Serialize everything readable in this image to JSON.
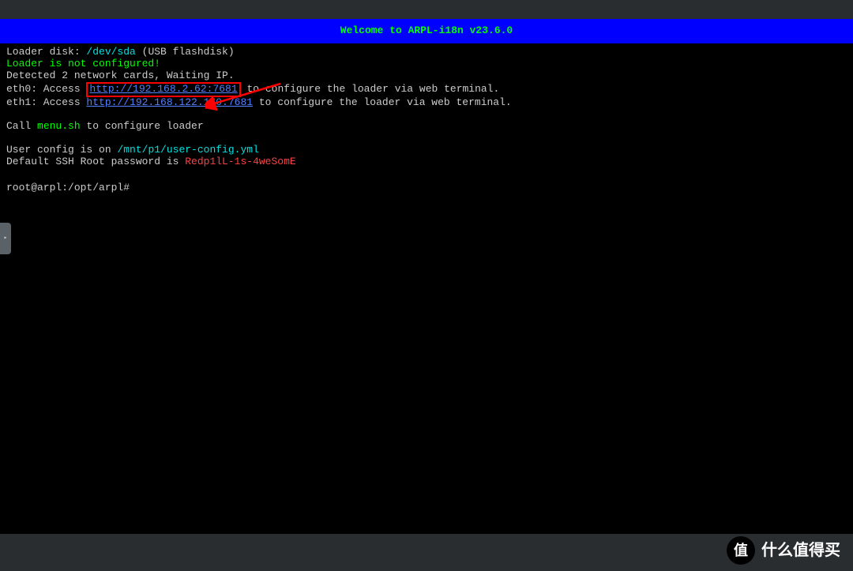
{
  "banner": {
    "text": "Welcome to ARPL-i18n v23.6.0"
  },
  "lines": {
    "loader_disk_label": "Loader disk: ",
    "loader_disk_path": "/dev/sda",
    "loader_disk_suffix": " (USB flashdisk)",
    "not_configured": "Loader is not configured!",
    "detected": "Detected 2 network cards, Waiting IP.",
    "eth0_prefix": "eth0: Access ",
    "eth0_url": "http://192.168.2.62:7681",
    "eth0_suffix": " to configure the loader via web terminal.",
    "eth1_prefix": "eth1: Access ",
    "eth1_url": "http://192.168.122.160:7681",
    "eth1_suffix": " to configure the loader via web terminal.",
    "call_prefix": "Call ",
    "call_cmd": "menu.sh",
    "call_suffix": " to configure loader",
    "user_config_prefix": "User config is on ",
    "user_config_path": "/mnt/p1/user-config.yml",
    "ssh_prefix": "Default SSH Root password is ",
    "ssh_password": "Redp1lL-1s-4weSomE",
    "prompt": "root@arpl:/opt/arpl#"
  },
  "watermark": {
    "badge": "值",
    "text": "什么值得买"
  }
}
